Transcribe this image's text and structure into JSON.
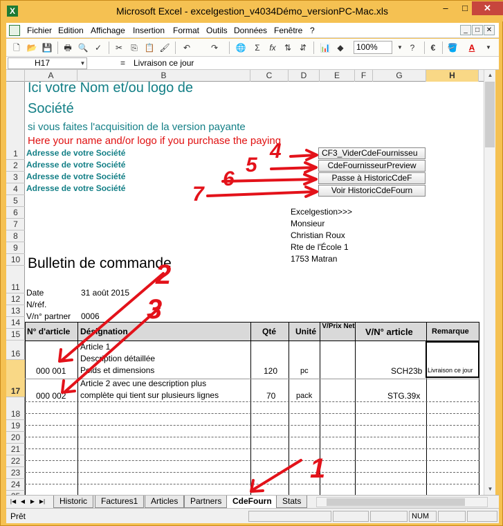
{
  "window": {
    "title": "Microsoft Excel - excelgestion_v4034Démo_versionPC-Mac.xls",
    "minimize": "–",
    "maximize": "□",
    "close": "✕"
  },
  "menu": {
    "items": [
      "Fichier",
      "Edition",
      "Affichage",
      "Insertion",
      "Format",
      "Outils",
      "Données",
      "Fenêtre",
      "?"
    ],
    "doc_buttons": [
      "_",
      "□",
      "✕"
    ]
  },
  "toolbar": {
    "zoom": "100%",
    "sigma": "Σ",
    "fx": "fx",
    "euro": "€",
    "font_color": "A"
  },
  "formula_bar": {
    "name_box": "H17",
    "equals": "=",
    "content": "Livraison ce jour"
  },
  "columns": [
    "A",
    "B",
    "C",
    "D",
    "E",
    "F",
    "G",
    "H"
  ],
  "rows": [
    "1",
    "2",
    "3",
    "4",
    "5",
    "6",
    "7",
    "8",
    "9",
    "10",
    "11",
    "12",
    "13",
    "14",
    "15",
    "16",
    "17",
    "18",
    "19",
    "20",
    "21",
    "22",
    "23",
    "24",
    "25"
  ],
  "company": {
    "line1": "Ici votre Nom et/ou logo de",
    "line2": "Société",
    "line3": "si vous faites l'acquisition de la version payante",
    "line4": "Here your name and/or logo if you purchase the paying",
    "address": [
      "Adresse de votre Société",
      "Adresse de votre Société",
      "Adresse de votre Société",
      "Adresse de votre Société"
    ]
  },
  "buttons": [
    "CF3_ViderCdeFournisseu",
    "CdeFournisseurPreview",
    "Passe à HistoricCdeF",
    "Voir HistoricCdeFourn"
  ],
  "supplier": {
    "lines": [
      "Excelgestion>>>",
      "Monsieur",
      "Christian Roux",
      "Rte de l'École 1",
      "1753 Matran"
    ]
  },
  "document": {
    "title": "Bulletin de commande",
    "date_label": "Date",
    "date_value": "31 août 2015",
    "ref_label": "N/réf.",
    "partner_label": "V/n° partner",
    "partner_value": "0006"
  },
  "table": {
    "headers": {
      "article": "N° d'article",
      "designation": "Désignation",
      "qty": "Qté",
      "unit": "Unité",
      "price": "V/Prix Net",
      "vn_article": "V/N° article",
      "remark": "Remarque"
    },
    "rows": [
      {
        "article": "000 001",
        "designation": [
          "Article 1",
          "Description  détaillée",
          "Poids et dimensions"
        ],
        "qty": "120",
        "unit": "pc",
        "vn_article": "SCH23b",
        "remark": "Livraison ce jour"
      },
      {
        "article": "000 002",
        "designation": [
          "Article 2 avec une description plus",
          "complète qui tient sur plusieurs lignes"
        ],
        "qty": "70",
        "unit": "pack",
        "vn_article": "STG.39x",
        "remark": ""
      }
    ]
  },
  "sheet_tabs": [
    "Historic",
    "Factures1",
    "Articles",
    "Partners",
    "CdeFourn",
    "Stats"
  ],
  "active_tab": "CdeFourn",
  "status": {
    "ready": "Prêt",
    "num": "NUM"
  },
  "annotations": [
    "1",
    "2",
    "3",
    "4",
    "5",
    "6",
    "7"
  ]
}
